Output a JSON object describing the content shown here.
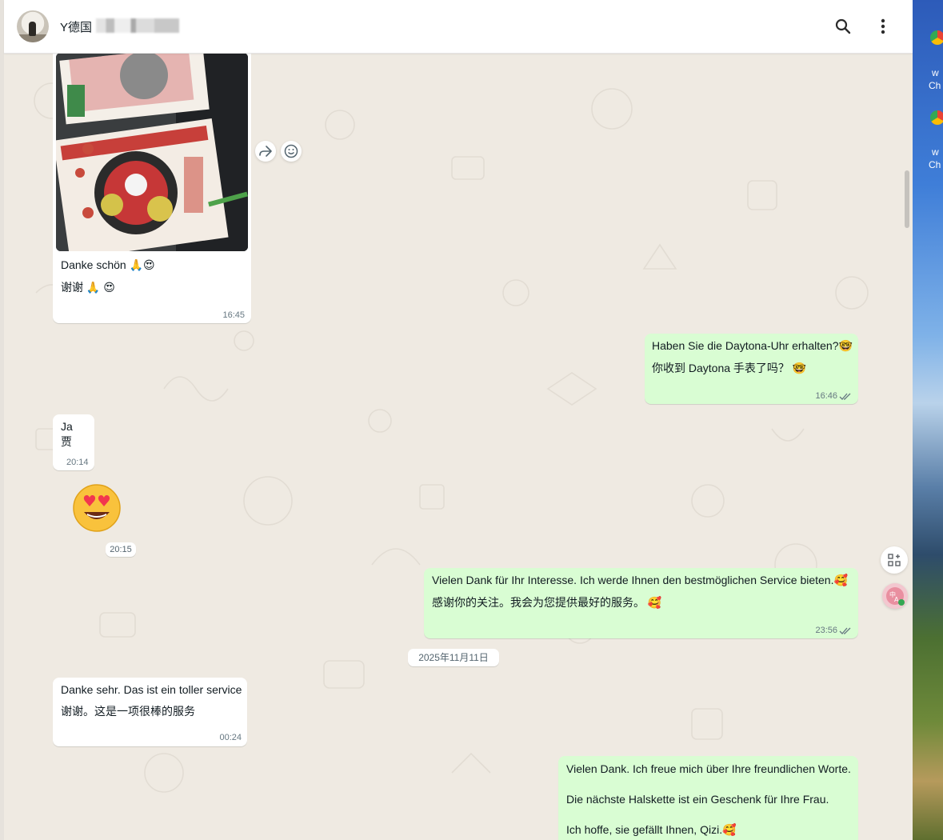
{
  "header": {
    "contact_name": "Y德国",
    "icons": [
      "search-icon",
      "more-vertical-icon"
    ]
  },
  "messages": [
    {
      "id": "m1",
      "dir": "in",
      "type": "image",
      "lines": [
        "Danke schön 🙏😍",
        "谢谢 🙏 😍"
      ],
      "time": "16:45"
    },
    {
      "id": "m2",
      "dir": "out",
      "lines": [
        "Haben Sie die Daytona-Uhr erhalten?🤓",
        "你收到 Daytona 手表了吗？ 🤓"
      ],
      "time": "16:46",
      "status": "read"
    },
    {
      "id": "m3",
      "dir": "in",
      "lines": [
        "Ja",
        "贾"
      ],
      "time": "20:14"
    },
    {
      "id": "m4",
      "dir": "in",
      "type": "sticker",
      "emoji": "😍",
      "time": "20:15"
    },
    {
      "id": "m5",
      "dir": "out",
      "lines": [
        "Vielen Dank für Ihr Interesse. Ich werde Ihnen den bestmöglichen Service bieten.🥰",
        "感谢你的关注。我会为您提供最好的服务。 🥰"
      ],
      "time": "23:56",
      "status": "read"
    },
    {
      "id": "m6",
      "dir": "in",
      "lines": [
        "Danke sehr. Das ist ein toller service",
        "谢谢。这是一项很棒的服务"
      ],
      "time": "00:24"
    },
    {
      "id": "m7",
      "dir": "out",
      "lines": [
        "Vielen Dank. Ich freue mich über Ihre freundlichen Worte.",
        "Die nächste Halskette ist ein Geschenk für Ihre Frau.",
        "Ich hoffe, sie gefällt Ihnen, Qizi.🥰"
      ]
    }
  ],
  "date_separator": "2025年11月11日",
  "desktop": {
    "labels": [
      "w",
      "Ch",
      "w",
      "Ch"
    ]
  },
  "colors": {
    "chat_bg": "#efeae2",
    "incoming": "#ffffff",
    "outgoing": "#d9fdd3",
    "read_ticks": "#53bdeb"
  }
}
